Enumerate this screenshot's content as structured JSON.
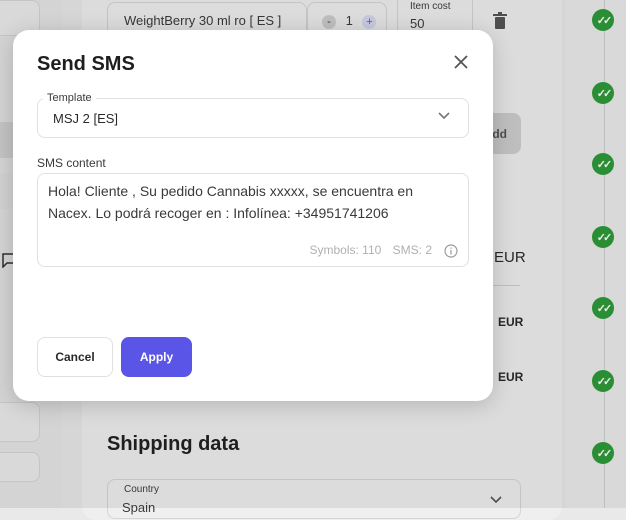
{
  "background": {
    "product_select_value": "WeightBerry 30 ml ro [ ES ]",
    "quantity_minus": "-",
    "quantity_value": "1",
    "quantity_plus": "+",
    "item_cost_label": "Item cost",
    "item_cost_value": "50",
    "add_button_partial": "dd",
    "eur_labels": [
      "EUR",
      "EUR",
      "EUR"
    ],
    "shipping_title": "Shipping data",
    "country_label": "Country",
    "country_value": "Spain",
    "status_check_count": 7
  },
  "modal": {
    "title": "Send SMS",
    "template_label": "Template",
    "template_value": "MSJ 2 [ES]",
    "sms_content_label": "SMS content",
    "sms_text": "Hola! Cliente , Su pedido Cannabis xxxxx, se encuentra en Nacex. Lo podrá recoger en : Infolínea: +34951741206",
    "symbols": "Symbols: 110",
    "sms_count": "SMS: 2",
    "cancel_label": "Cancel",
    "apply_label": "Apply"
  },
  "colors": {
    "accent": "#5a55e6",
    "status_green": "#2e9b39"
  }
}
